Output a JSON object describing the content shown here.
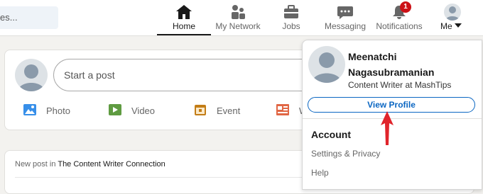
{
  "search": {
    "partial_text": "es..."
  },
  "nav": {
    "home": {
      "label": "Home",
      "icon": "home-icon"
    },
    "network": {
      "label": "My Network",
      "icon": "people-icon"
    },
    "jobs": {
      "label": "Jobs",
      "icon": "briefcase-icon"
    },
    "messaging": {
      "label": "Messaging",
      "icon": "chat-icon"
    },
    "notifications": {
      "label": "Notifications",
      "icon": "bell-icon",
      "badge": "1"
    },
    "me": {
      "label": "Me"
    }
  },
  "composer": {
    "placeholder": "Start a post",
    "actions": [
      {
        "label": "Photo",
        "icon": "photo-icon",
        "color": "#378fe9"
      },
      {
        "label": "Video",
        "icon": "video-icon",
        "color": "#5f9b41"
      },
      {
        "label": "Event",
        "icon": "calendar-icon",
        "color": "#c37d16"
      },
      {
        "label": "W",
        "icon": "article-icon",
        "color": "#e16745"
      }
    ]
  },
  "feed": {
    "prefix": "New post in",
    "group": "The Content Writer Connection"
  },
  "profile_menu": {
    "name": "Meenatchi Nagasubramanian",
    "headline": "Content Writer at MashTips",
    "view_profile": "View Profile",
    "account_heading": "Account",
    "settings": "Settings & Privacy",
    "help": "Help"
  },
  "colors": {
    "accent": "#0a66c2",
    "badge": "#cc1016",
    "annotation_arrow": "#e0242b"
  }
}
